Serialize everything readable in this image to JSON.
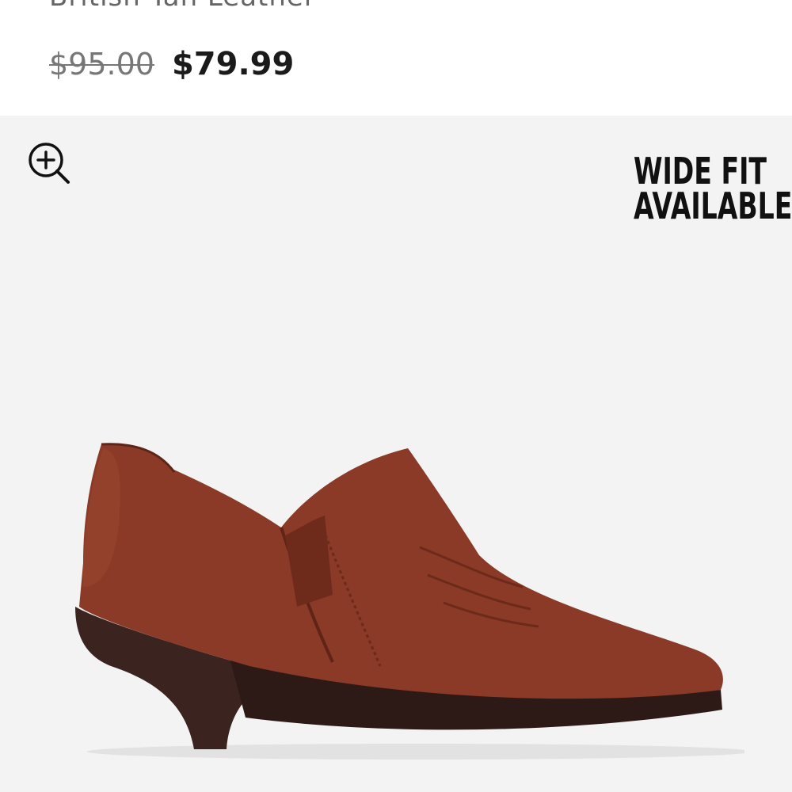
{
  "product": {
    "color_name": "British Tan Leather",
    "price_original": "$95.00",
    "price_sale": "$79.99"
  },
  "gallery": {
    "zoom_icon": "zoom-in-icon",
    "badge_line1": "WIDE FIT",
    "badge_line2": "AVAILABLE"
  },
  "colors": {
    "gallery_background": "#f3f3f3",
    "leather": "#8a3a26",
    "heel": "#3b2320"
  }
}
